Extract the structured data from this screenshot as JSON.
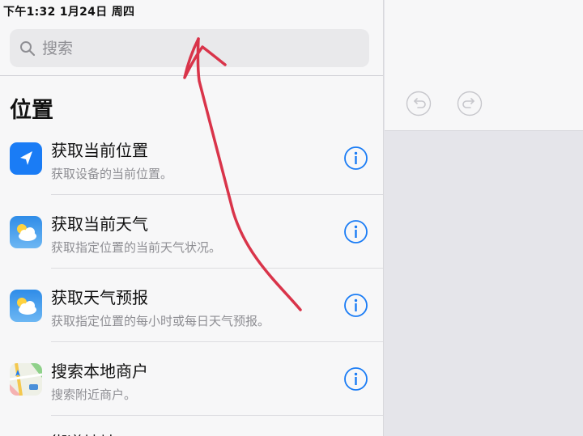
{
  "status_bar": {
    "time_date": "下午1:32   1月24日 周四"
  },
  "search": {
    "placeholder": "搜索"
  },
  "section": {
    "title": "位置"
  },
  "actions": [
    {
      "title": "获取当前位置",
      "subtitle": "获取设备的当前位置。",
      "icon": "location-arrow-icon"
    },
    {
      "title": "获取当前天气",
      "subtitle": "获取指定位置的当前天气状况。",
      "icon": "weather-icon"
    },
    {
      "title": "获取天气预报",
      "subtitle": "获取指定位置的每小时或每日天气预报。",
      "icon": "weather-icon"
    },
    {
      "title": "搜索本地商户",
      "subtitle": "搜索附近商户。",
      "icon": "maps-icon"
    }
  ],
  "partial_next": {
    "title": "街道地址"
  },
  "colors": {
    "accent_blue": "#1a7cf5",
    "annotation_red": "#d9344a"
  }
}
